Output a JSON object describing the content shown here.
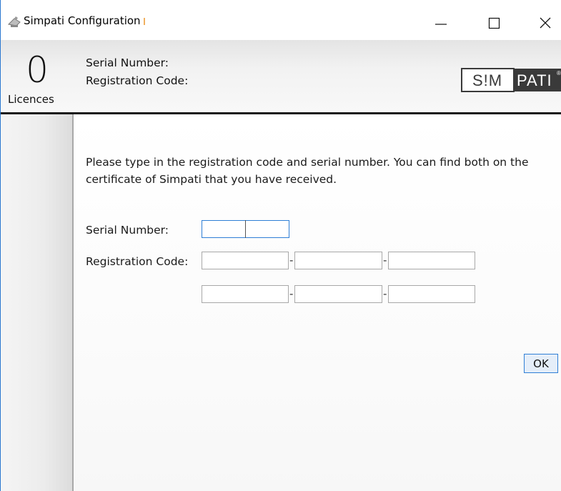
{
  "window": {
    "title": "Simpati Configuration",
    "app_icon": "satellite-dish-icon",
    "controls": {
      "minimize_icon": "minimize-icon",
      "maximize_icon": "maximize-icon",
      "close_icon": "close-icon"
    }
  },
  "header": {
    "licence_count": "0",
    "licence_label": "Licences",
    "serial_label": "Serial Number:",
    "registration_label": "Registration Code:",
    "logo": {
      "left": "S!M",
      "right": "PATI",
      "mark": "®"
    }
  },
  "form": {
    "instructions": "Please type in the registration code and serial number. You can find both on the certificate of Simpati that you have received.",
    "serial_label": "Serial Number:",
    "serial_values": [
      "",
      ""
    ],
    "registration_label": "Registration Code:",
    "registration_values": [
      "",
      "",
      "",
      "",
      "",
      ""
    ],
    "separator": "-",
    "ok_label": "OK"
  },
  "colors": {
    "accent": "#2f7fd6",
    "header_rule": "#1a1a1a",
    "logo_dark": "#3a3a3a"
  }
}
